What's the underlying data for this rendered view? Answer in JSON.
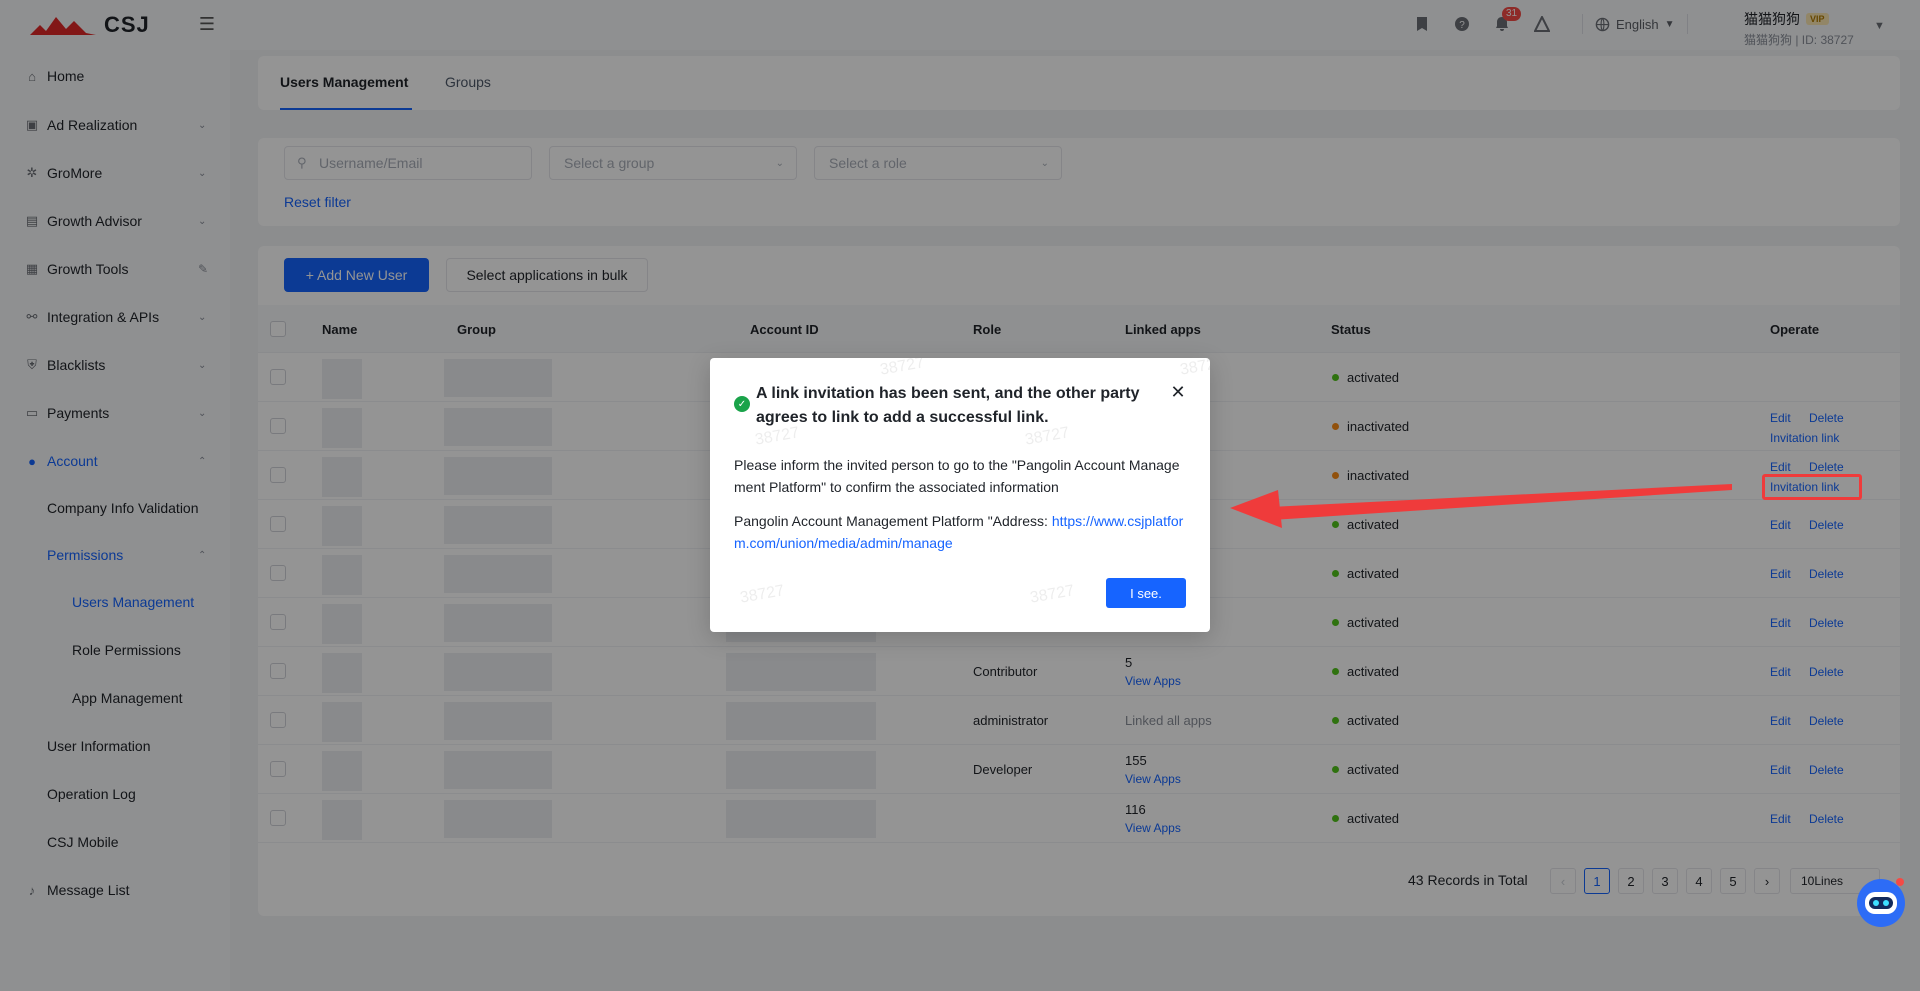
{
  "header": {
    "logo_text": "CSJ",
    "notification_count": "31",
    "language": "English",
    "user_name": "猫猫狗狗",
    "vip_label": "VIP",
    "user_sub": "猫猫狗狗  |  ID: 38727"
  },
  "sidebar": {
    "items": [
      {
        "label": "Home",
        "icon": "home-icon"
      },
      {
        "label": "Ad Realization",
        "icon": "ad-icon"
      },
      {
        "label": "GroMore",
        "icon": "gromore-icon"
      },
      {
        "label": "Growth Advisor",
        "icon": "advisor-icon"
      },
      {
        "label": "Growth Tools",
        "icon": "tools-icon"
      },
      {
        "label": "Integration & APIs",
        "icon": "integration-icon"
      },
      {
        "label": "Blacklists",
        "icon": "shield-icon"
      },
      {
        "label": "Payments",
        "icon": "wallet-icon"
      },
      {
        "label": "Account",
        "icon": "user-icon"
      },
      {
        "label": "Company Info Validation"
      },
      {
        "label": "Permissions"
      },
      {
        "label": "Users Management"
      },
      {
        "label": "Role Permissions"
      },
      {
        "label": "App Management"
      },
      {
        "label": "User Information"
      },
      {
        "label": "Operation Log"
      },
      {
        "label": "CSJ Mobile"
      },
      {
        "label": "Message List",
        "icon": "bell-icon"
      }
    ]
  },
  "tabs": {
    "users": "Users Management",
    "groups": "Groups"
  },
  "filters": {
    "search_placeholder": "Username/Email",
    "group_placeholder": "Select a group",
    "role_placeholder": "Select a role",
    "reset": "Reset filter"
  },
  "actions": {
    "add_user": "+ Add New User",
    "bulk_select": "Select applications in bulk"
  },
  "table": {
    "headers": [
      "Name",
      "Group",
      "Account ID",
      "Role",
      "Linked apps",
      "Status",
      "Operate"
    ],
    "rows": [
      {
        "role": "",
        "apps": "",
        "apps_link": "",
        "status": "activated",
        "status_color": "#52c41a",
        "ops": []
      },
      {
        "role": "",
        "apps": "",
        "apps_link": "",
        "status": "inactivated",
        "status_color": "#fa8c16",
        "ops": [
          "Edit",
          "Delete",
          "Invitation link"
        ]
      },
      {
        "role": "",
        "apps": "",
        "apps_link": "",
        "status": "inactivated",
        "status_color": "#fa8c16",
        "ops": [
          "Edit",
          "Delete",
          "Invitation link"
        ]
      },
      {
        "role": "",
        "apps": "",
        "apps_link": "",
        "status": "activated",
        "status_color": "#52c41a",
        "ops": [
          "Edit",
          "Delete"
        ]
      },
      {
        "role": "",
        "apps": "",
        "apps_link": "",
        "status": "activated",
        "status_color": "#52c41a",
        "ops": [
          "Edit",
          "Delete"
        ]
      },
      {
        "role": "",
        "apps": "",
        "apps_link": "",
        "status": "activated",
        "status_color": "#52c41a",
        "ops": [
          "Edit",
          "Delete"
        ]
      },
      {
        "role": "Contributor",
        "apps": "5",
        "apps_link": "View Apps",
        "status": "activated",
        "status_color": "#52c41a",
        "ops": [
          "Edit",
          "Delete"
        ]
      },
      {
        "role": "administrator",
        "apps": "Linked all apps",
        "apps_link": "",
        "status": "activated",
        "status_color": "#52c41a",
        "ops": [
          "Edit",
          "Delete"
        ]
      },
      {
        "role": "Developer",
        "apps": "155",
        "apps_link": "View Apps",
        "status": "activated",
        "status_color": "#52c41a",
        "ops": [
          "Edit",
          "Delete"
        ]
      },
      {
        "role": "",
        "apps": "116",
        "apps_link": "View Apps",
        "status": "activated",
        "status_color": "#52c41a",
        "ops": [
          "Edit",
          "Delete"
        ]
      }
    ]
  },
  "pagination": {
    "total": "43 Records in Total",
    "pages": [
      "1",
      "2",
      "3",
      "4",
      "5"
    ],
    "current": "1",
    "prev": "‹",
    "next": "›",
    "page_size": "10Lines"
  },
  "modal": {
    "title": "A link invitation has been sent, and the other party agrees to link to add a successful link.",
    "body1": "Please inform the invited person to go to the \"Pangolin Account Management Platform\" to confirm the associated information",
    "body2_prefix": "Pangolin Account Management Platform \"Address: ",
    "url": "https://www.csjplatform.com/union/media/admin/manage",
    "confirm": "I see.",
    "watermark": "38727"
  },
  "colors": {
    "primary": "#1664ff",
    "annotation": "#ef3b3b",
    "success": "#52c41a",
    "warning": "#fa8c16"
  }
}
